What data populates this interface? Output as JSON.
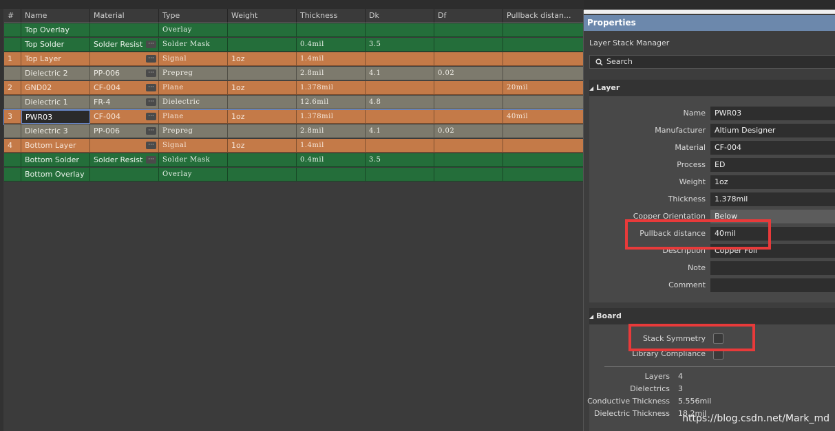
{
  "table": {
    "headers": [
      "#",
      "Name",
      "Material",
      "Type",
      "Weight",
      "Thickness",
      "Dk",
      "Df",
      "Pullback distan..."
    ],
    "rows": [
      {
        "num": "",
        "name": "Top Overlay",
        "material": "",
        "has_dots": false,
        "type": "Overlay",
        "weight": "",
        "thickness": "",
        "dk": "",
        "df": "",
        "pullback": "",
        "color": "green"
      },
      {
        "num": "",
        "name": "Top Solder",
        "material": "Solder Resist",
        "has_dots": true,
        "type": "Solder Mask",
        "weight": "",
        "thickness": "0.4mil",
        "dk": "3.5",
        "df": "",
        "pullback": "",
        "color": "green"
      },
      {
        "num": "1",
        "name": "Top Layer",
        "material": "",
        "has_dots": true,
        "type": "Signal",
        "weight": "1oz",
        "thickness": "1.4mil",
        "dk": "",
        "df": "",
        "pullback": "",
        "color": "orange"
      },
      {
        "num": "",
        "name": "Dielectric 2",
        "material": "PP-006",
        "has_dots": true,
        "type": "Prepreg",
        "weight": "",
        "thickness": "2.8mil",
        "dk": "4.1",
        "df": "0.02",
        "pullback": "",
        "color": "gray"
      },
      {
        "num": "2",
        "name": "GND02",
        "material": "CF-004",
        "has_dots": true,
        "type": "Plane",
        "weight": "1oz",
        "thickness": "1.378mil",
        "dk": "",
        "df": "",
        "pullback": "20mil",
        "color": "orange"
      },
      {
        "num": "",
        "name": "Dielectric 1",
        "material": "FR-4",
        "has_dots": true,
        "type": "Dielectric",
        "weight": "",
        "thickness": "12.6mil",
        "dk": "4.8",
        "df": "",
        "pullback": "",
        "color": "gray"
      },
      {
        "num": "3",
        "name": "PWR03",
        "material": "CF-004",
        "has_dots": true,
        "type": "Plane",
        "weight": "1oz",
        "thickness": "1.378mil",
        "dk": "",
        "df": "",
        "pullback": "40mil",
        "color": "orange",
        "selected": true
      },
      {
        "num": "",
        "name": "Dielectric 3",
        "material": "PP-006",
        "has_dots": true,
        "type": "Prepreg",
        "weight": "",
        "thickness": "2.8mil",
        "dk": "4.1",
        "df": "0.02",
        "pullback": "",
        "color": "gray"
      },
      {
        "num": "4",
        "name": "Bottom Layer",
        "material": "",
        "has_dots": true,
        "type": "Signal",
        "weight": "1oz",
        "thickness": "1.4mil",
        "dk": "",
        "df": "",
        "pullback": "",
        "color": "orange"
      },
      {
        "num": "",
        "name": "Bottom Solder",
        "material": "Solder Resist",
        "has_dots": true,
        "type": "Solder Mask",
        "weight": "",
        "thickness": "0.4mil",
        "dk": "3.5",
        "df": "",
        "pullback": "",
        "color": "green"
      },
      {
        "num": "",
        "name": "Bottom Overlay",
        "material": "",
        "has_dots": false,
        "type": "Overlay",
        "weight": "",
        "thickness": "",
        "dk": "",
        "df": "",
        "pullback": "",
        "color": "green"
      }
    ]
  },
  "properties": {
    "title": "Properties",
    "subtitle": "Layer Stack Manager",
    "search_placeholder": "Search",
    "layer_section": "Layer",
    "fields": [
      {
        "label": "Name",
        "value": "PWR03"
      },
      {
        "label": "Manufacturer",
        "value": "Altium Designer"
      },
      {
        "label": "Material",
        "value": "CF-004"
      },
      {
        "label": "Process",
        "value": "ED"
      },
      {
        "label": "Weight",
        "value": "1oz"
      },
      {
        "label": "Thickness",
        "value": "1.378mil"
      },
      {
        "label": "Copper Orientation",
        "value": "Below"
      },
      {
        "label": "Pullback distance",
        "value": "40mil"
      },
      {
        "label": "Description",
        "value": "Copper Foil"
      },
      {
        "label": "Note",
        "value": ""
      },
      {
        "label": "Comment",
        "value": ""
      }
    ],
    "board_section": "Board",
    "stack_symmetry_label": "Stack Symmetry",
    "stack_symmetry_checked": false,
    "library_compliance_label": "Library Compliance",
    "library_compliance_checked": false,
    "stats": [
      {
        "label": "Layers",
        "value": "4"
      },
      {
        "label": "Dielectrics",
        "value": "3"
      },
      {
        "label": "Conductive Thickness",
        "value": "5.556mil"
      },
      {
        "label": "Dielectric Thickness",
        "value": "18.2mil"
      }
    ]
  },
  "watermark": "https://blog.csdn.net/Mark_md",
  "colors": {
    "highlight": "#e83a3a",
    "signal": "#c47a48",
    "mask": "#246e3a",
    "dielectric": "#7d7a6d"
  }
}
